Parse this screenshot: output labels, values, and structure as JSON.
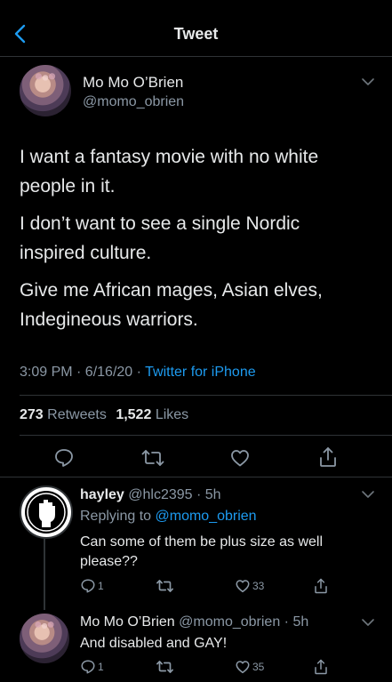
{
  "header": {
    "title": "Tweet"
  },
  "main_tweet": {
    "display_name": "Mo Mo O’Brien",
    "handle": "@momo_obrien",
    "paragraphs": [
      "I want a fantasy movie with no white\npeople in it.",
      "I don’t want to see a single Nordic\ninspired culture.",
      "Give me African mages, Asian elves,\nIndegineous warriors."
    ],
    "time_date": "3:09 PM · 6/16/20 · ",
    "client": "Twitter for iPhone",
    "retweets_count": "273",
    "retweets_label": "Retweets",
    "likes_count": "1,522",
    "likes_label": "Likes"
  },
  "replies": [
    {
      "display_name": "hayley",
      "handle_time": "@hlc2395 · 5h",
      "replying_prefix": "Replying to ",
      "replying_to": "@momo_obrien",
      "text": "Can some of them be plus size as well\nplease??",
      "reply_count": "1",
      "like_count": "33"
    },
    {
      "display_name": "Mo Mo O’Brien",
      "handle_time": "@momo_obrien · 5h",
      "text": "And disabled and GAY!",
      "reply_count": "1",
      "like_count": "35"
    }
  ],
  "colors": {
    "background": "#000000",
    "accent": "#1d9bf0",
    "muted": "#8b98a5",
    "divider": "#2f3336"
  },
  "icons": [
    "back-chevron-icon",
    "chevron-down-icon",
    "reply-icon",
    "retweet-icon",
    "like-icon",
    "share-icon"
  ]
}
